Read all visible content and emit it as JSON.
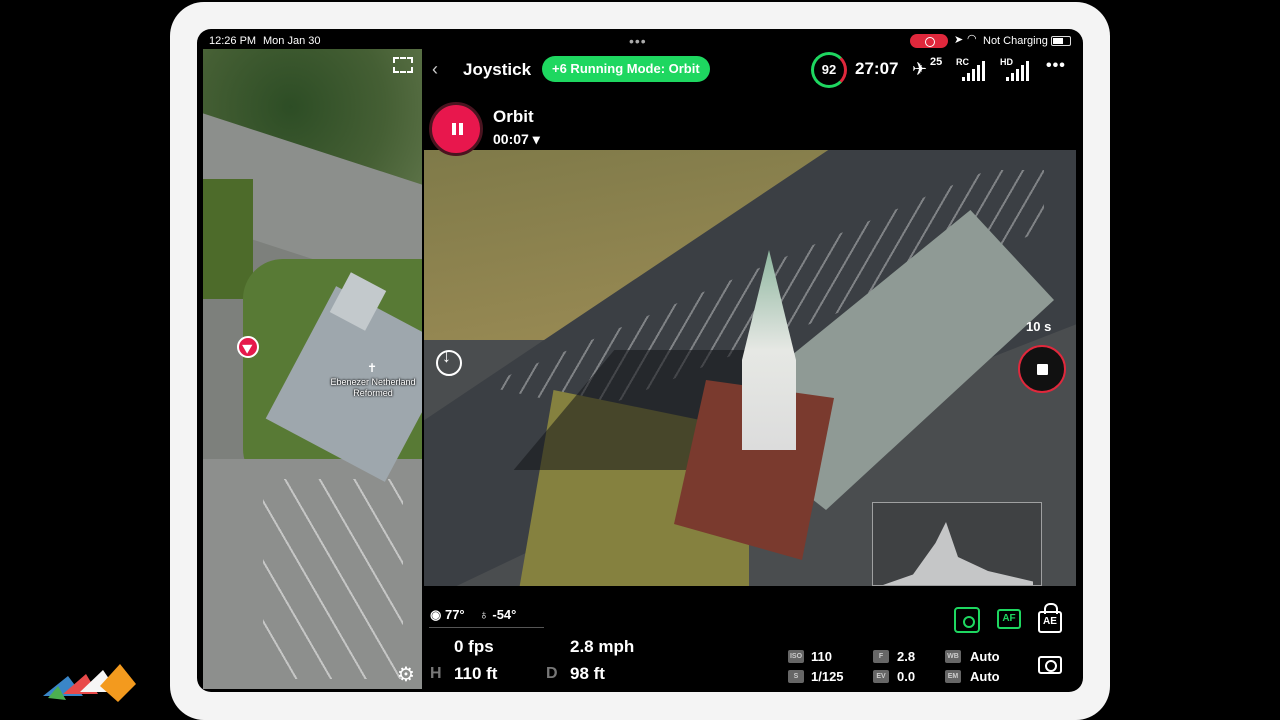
{
  "status_bar": {
    "time": "12:26 PM",
    "date": "Mon Jan 30",
    "charging": "Not Charging"
  },
  "map": {
    "place_label": "Ebenezer Netherland Reformed"
  },
  "top_bar": {
    "back_icon": "chevron-left-icon",
    "mode_title": "Joystick",
    "running_mode": "+6 Running Mode: Orbit",
    "battery_percent": "92",
    "flight_time": "27:07",
    "satellite_count": "25",
    "rc_label": "RC",
    "hd_label": "HD",
    "more_icon": "more-dots-icon"
  },
  "orbit": {
    "title": "Orbit",
    "elapsed": "00:07 ▾"
  },
  "recording": {
    "countdown": "10 s"
  },
  "telemetry": {
    "heading": "77°",
    "gimbal_pitch": "-54°",
    "vertical_speed": "0 fps",
    "horizontal_speed": "2.8 mph",
    "height_key": "H",
    "height": "110 ft",
    "distance_key": "D",
    "distance": "98 ft"
  },
  "camera": {
    "iso_key": "ISO",
    "iso": "110",
    "shutter_key": "S",
    "shutter": "1/125",
    "aperture_key": "F",
    "aperture": "2.8",
    "ev_key": "EV",
    "ev": "0.0",
    "wb_key": "WB",
    "wb": "Auto",
    "em_key": "EM",
    "em": "Auto",
    "af_label": "AF",
    "ae_label": "AE"
  },
  "colors": {
    "accent_green": "#1ed760",
    "record_red": "#e8174d"
  }
}
